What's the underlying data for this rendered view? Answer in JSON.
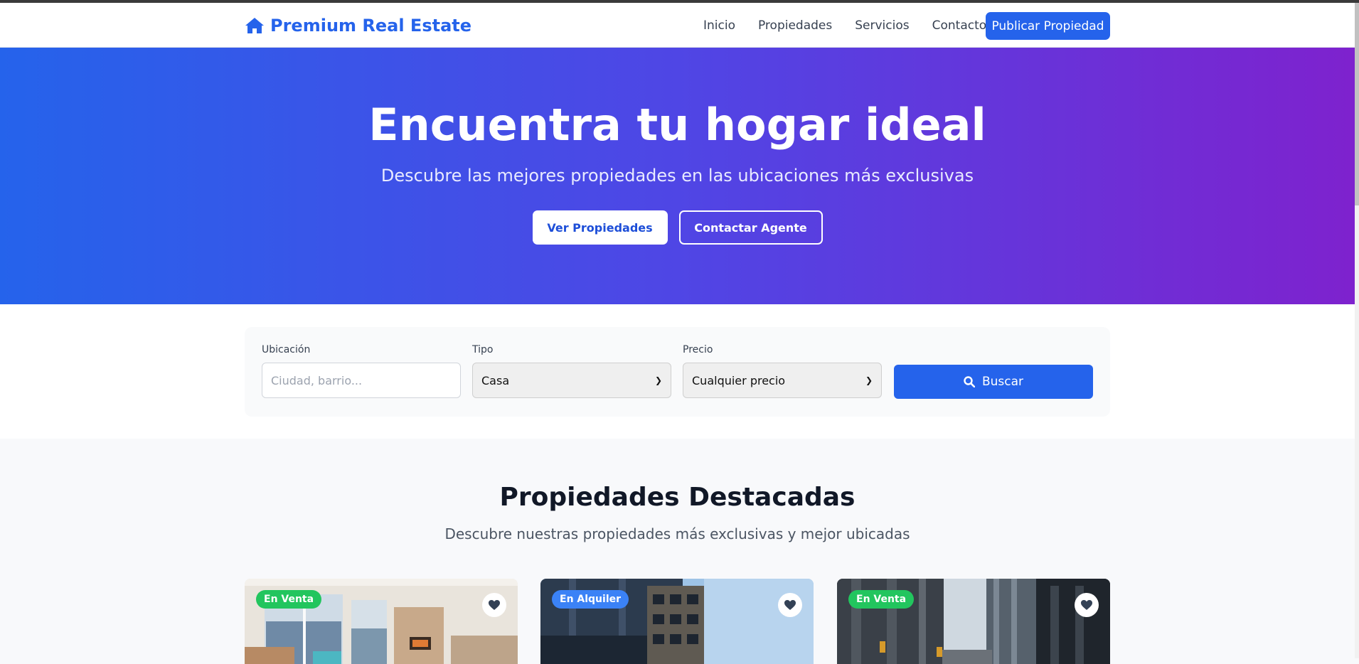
{
  "nav": {
    "brand": "Premium Real Estate",
    "links": [
      "Inicio",
      "Propiedades",
      "Servicios",
      "Contacto"
    ],
    "cta": "Publicar Propiedad"
  },
  "hero": {
    "title": "Encuentra tu hogar ideal",
    "subtitle": "Descubre las mejores propiedades en las ubicaciones más exclusivas",
    "primary_button": "Ver Propiedades",
    "secondary_button": "Contactar Agente"
  },
  "search": {
    "location_label": "Ubicación",
    "location_placeholder": "Ciudad, barrio...",
    "type_label": "Tipo",
    "type_value": "Casa",
    "price_label": "Precio",
    "price_value": "Cualquier precio",
    "button": "Buscar"
  },
  "featured": {
    "title": "Propiedades Destacadas",
    "subtitle": "Descubre nuestras propiedades más exclusivas y mejor ubicadas",
    "cards": [
      {
        "badge": "En Venta",
        "badge_color": "#22c55e"
      },
      {
        "badge": "En Alquiler",
        "badge_color": "#3b82f6"
      },
      {
        "badge": "En Venta",
        "badge_color": "#22c55e"
      }
    ]
  },
  "colors": {
    "accent": "#2563eb",
    "hero_start": "#2563eb",
    "hero_end": "#7e22ce"
  }
}
